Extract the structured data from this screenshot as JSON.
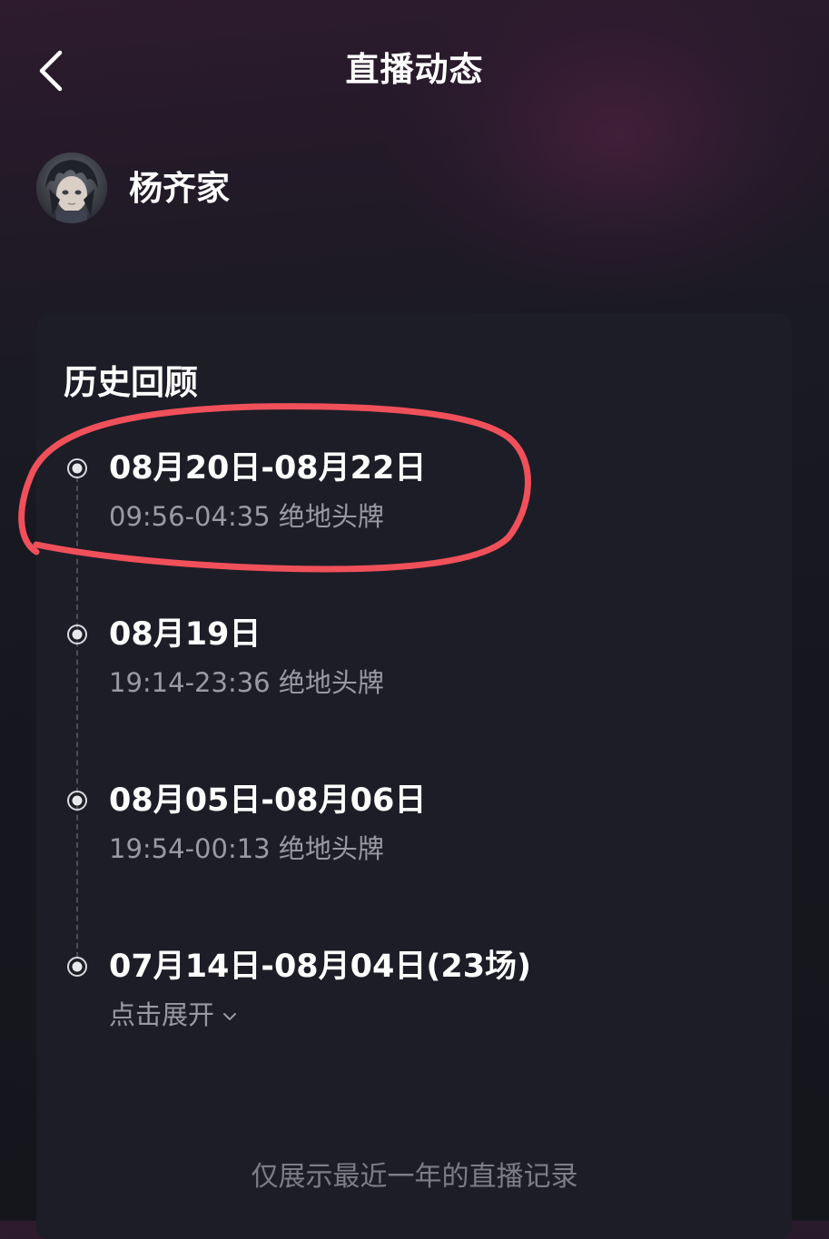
{
  "header": {
    "title": "直播动态",
    "back_icon": "chevron-left-icon"
  },
  "user": {
    "name": "杨齐家",
    "avatar_icon": "anime-avatar"
  },
  "history": {
    "title": "历史回顾",
    "items": [
      {
        "date": "08月20日-08月22日",
        "detail": "09:56-04:35 绝地头牌"
      },
      {
        "date": "08月19日",
        "detail": "19:14-23:36 绝地头牌"
      },
      {
        "date": "08月05日-08月06日",
        "detail": "19:54-00:13 绝地头牌"
      },
      {
        "date": "07月14日-08月04日(23场)",
        "detail": "点击展开"
      }
    ]
  },
  "footer": {
    "note": "仅展示最近一年的直播记录"
  },
  "colors": {
    "background": "#16161e",
    "card": "#1d1d27",
    "secondary_text": "#9a9aa3",
    "footer_text": "#7d7d86",
    "annotation_stroke": "#f0505a"
  }
}
